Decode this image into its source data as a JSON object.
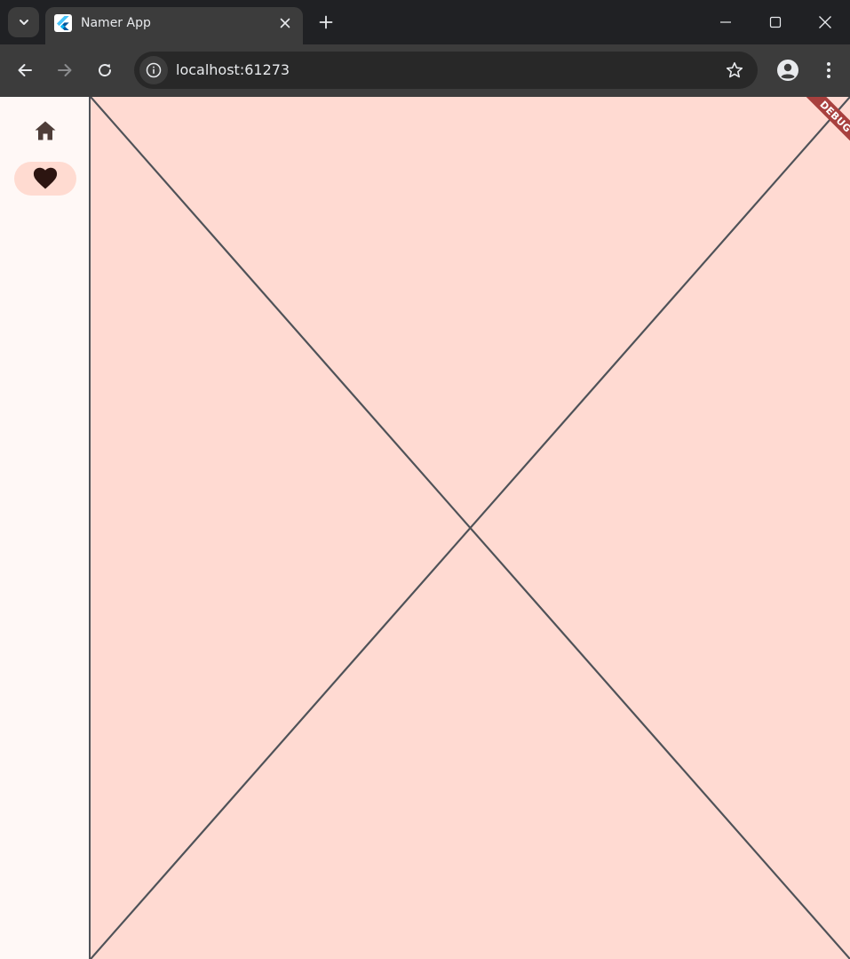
{
  "browser": {
    "tab": {
      "title": "Namer App",
      "favicon": "flutter-logo-icon"
    },
    "address_bar": {
      "url": "localhost:61273"
    },
    "icons": {
      "tab_search": "chevron-down-icon",
      "tab_close": "close-icon",
      "new_tab": "plus-icon",
      "back": "arrow-left-icon",
      "forward": "arrow-right-icon",
      "reload": "reload-icon",
      "site_info": "info-icon",
      "bookmark": "star-icon",
      "profile": "account-icon",
      "menu": "vertical-dots-icon",
      "minimize": "minimize-icon",
      "maximize": "maximize-icon",
      "close_window": "close-icon"
    }
  },
  "app": {
    "navigation_rail": {
      "destinations": [
        {
          "icon": "home-icon",
          "selected": false
        },
        {
          "icon": "heart-icon",
          "selected": true
        }
      ],
      "selected_indicator_color": "#ffdbd1"
    },
    "main": {
      "content": "placeholder",
      "background_color": "#ffdad2",
      "line_color": "#4f5258"
    },
    "debug_banner": {
      "label": "DEBUG",
      "color": "#a8403e"
    }
  }
}
